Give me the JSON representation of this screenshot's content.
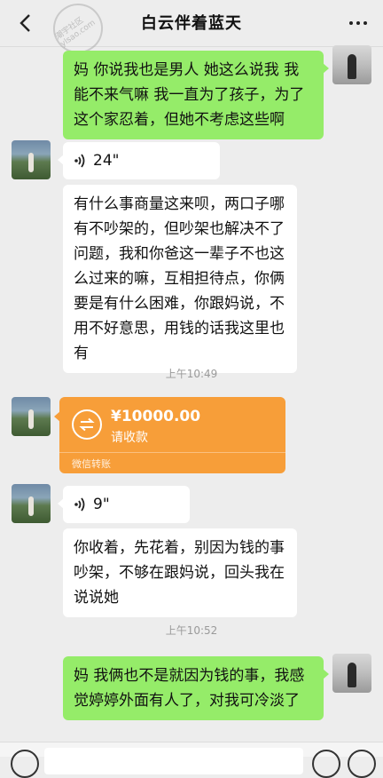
{
  "header": {
    "title": "白云伴着蓝天",
    "back_icon": "back-arrow-icon",
    "more_icon": "more-dots-icon",
    "watermark_text": "潮宇社区 ylsao.com"
  },
  "colors": {
    "background": "#ededed",
    "sent_bubble": "#95ec69",
    "received_bubble": "#ffffff",
    "transfer_card": "#f79e39"
  },
  "messages": {
    "m1_text": "妈 你说我也是男人 她这么说我 我能不来气嘛 我一直为了孩子，为了这个家忍着，但她不考虑这些啊",
    "m2_voice": "24\"",
    "m3_text": "有什么事商量这来呗，两口子哪有不吵架的，但吵架也解决不了问题，我和你爸这一辈子不也这么过来的嘛，互相担待点，你俩要是有什么困难，你跟妈说，不用不好意思，用钱的话我这里也有",
    "time1": "上午10:49",
    "transfer_amount": "¥10000.00",
    "transfer_status": "请收款",
    "transfer_footer": "微信转账",
    "m5_voice": "9\"",
    "m6_text": "你收着，先花着，别因为钱的事吵架，不够在跟妈说，回头我在说说她",
    "time2": "上午10:52",
    "m7_text": "妈 我俩也不是就因为钱的事，我感觉婷婷外面有人了，对我可冷淡了"
  }
}
